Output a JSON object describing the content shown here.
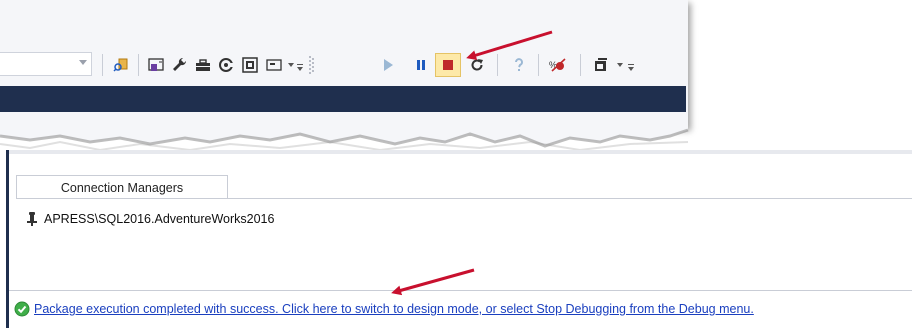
{
  "toolbar": {
    "buttons": [
      {
        "name": "find-in-files-icon",
        "color": "#c97a18"
      },
      {
        "name": "solution-explorer-icon",
        "color": "#6a3ea1"
      },
      {
        "name": "properties-wrench-icon",
        "color": "#333333"
      },
      {
        "name": "toolbox-icon",
        "color": "#333333"
      },
      {
        "name": "ssis-variables-icon",
        "color": "#333333"
      },
      {
        "name": "package-explorer-icon",
        "color": "#333333"
      },
      {
        "name": "window-layout-icon",
        "color": "#333333"
      },
      {
        "name": "start-debugging-icon",
        "color": "#9bb8d4"
      },
      {
        "name": "break-all-icon",
        "color": "#1f5bbf"
      },
      {
        "name": "stop-debugging-icon",
        "color": "#c0282a"
      },
      {
        "name": "restart-icon",
        "color": "#333333"
      },
      {
        "name": "help-icon",
        "color": "#9bb8d4"
      },
      {
        "name": "disable-breakpoints-icon",
        "color": "#c0282a"
      },
      {
        "name": "output-window-icon",
        "color": "#333333"
      }
    ]
  },
  "designer": {
    "tab_label": "Connection Managers",
    "connection_name": "APRESS\\SQL2016.AdventureWorks2016",
    "status_message": "Package execution completed with success. Click here to switch to design mode, or select Stop Debugging from the Debug menu."
  },
  "colors": {
    "accent_dark": "#1f2f4e",
    "link": "#1a3fbf",
    "success": "#3fae49",
    "arrow": "#c8102e",
    "highlight": "#fde9a8"
  }
}
